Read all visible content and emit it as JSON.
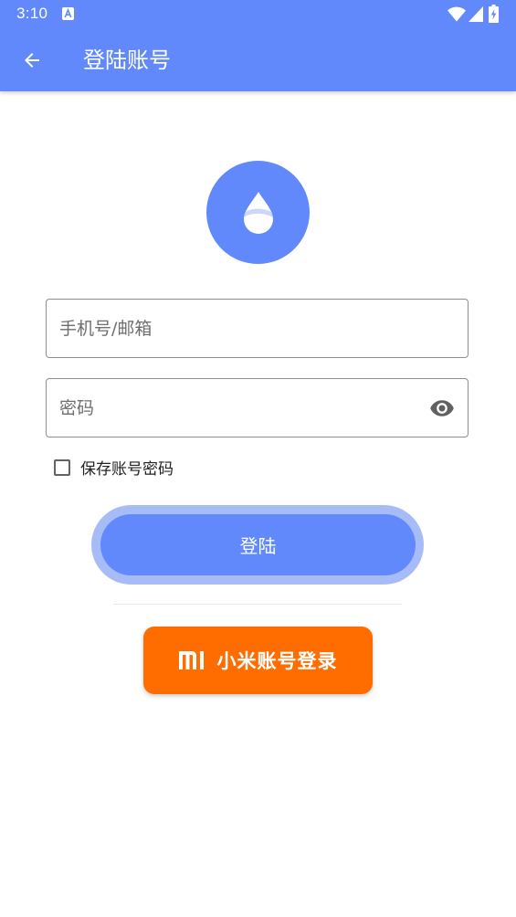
{
  "status_bar": {
    "time": "3:10",
    "icons": [
      "notification-a-icon",
      "wifi-icon",
      "signal-icon",
      "battery-charging-icon"
    ]
  },
  "app_bar": {
    "title": "登陆账号",
    "back_icon": "arrow-back-icon"
  },
  "logo": {
    "icon": "water-drop-icon"
  },
  "form": {
    "phone_placeholder": "手机号/邮箱",
    "phone_value": "",
    "password_placeholder": "密码",
    "password_value": "",
    "visibility_icon": "eye-icon",
    "remember_label": "保存账号密码",
    "remember_checked": false,
    "login_label": "登陆"
  },
  "mi_login": {
    "label": "小米账号登录",
    "logo_icon": "mi-logo-icon"
  },
  "colors": {
    "primary": "#6189fc",
    "primary_ring": "#a7bbf7",
    "mi_orange": "#ff6d00",
    "field_border": "#8e8e8e"
  }
}
